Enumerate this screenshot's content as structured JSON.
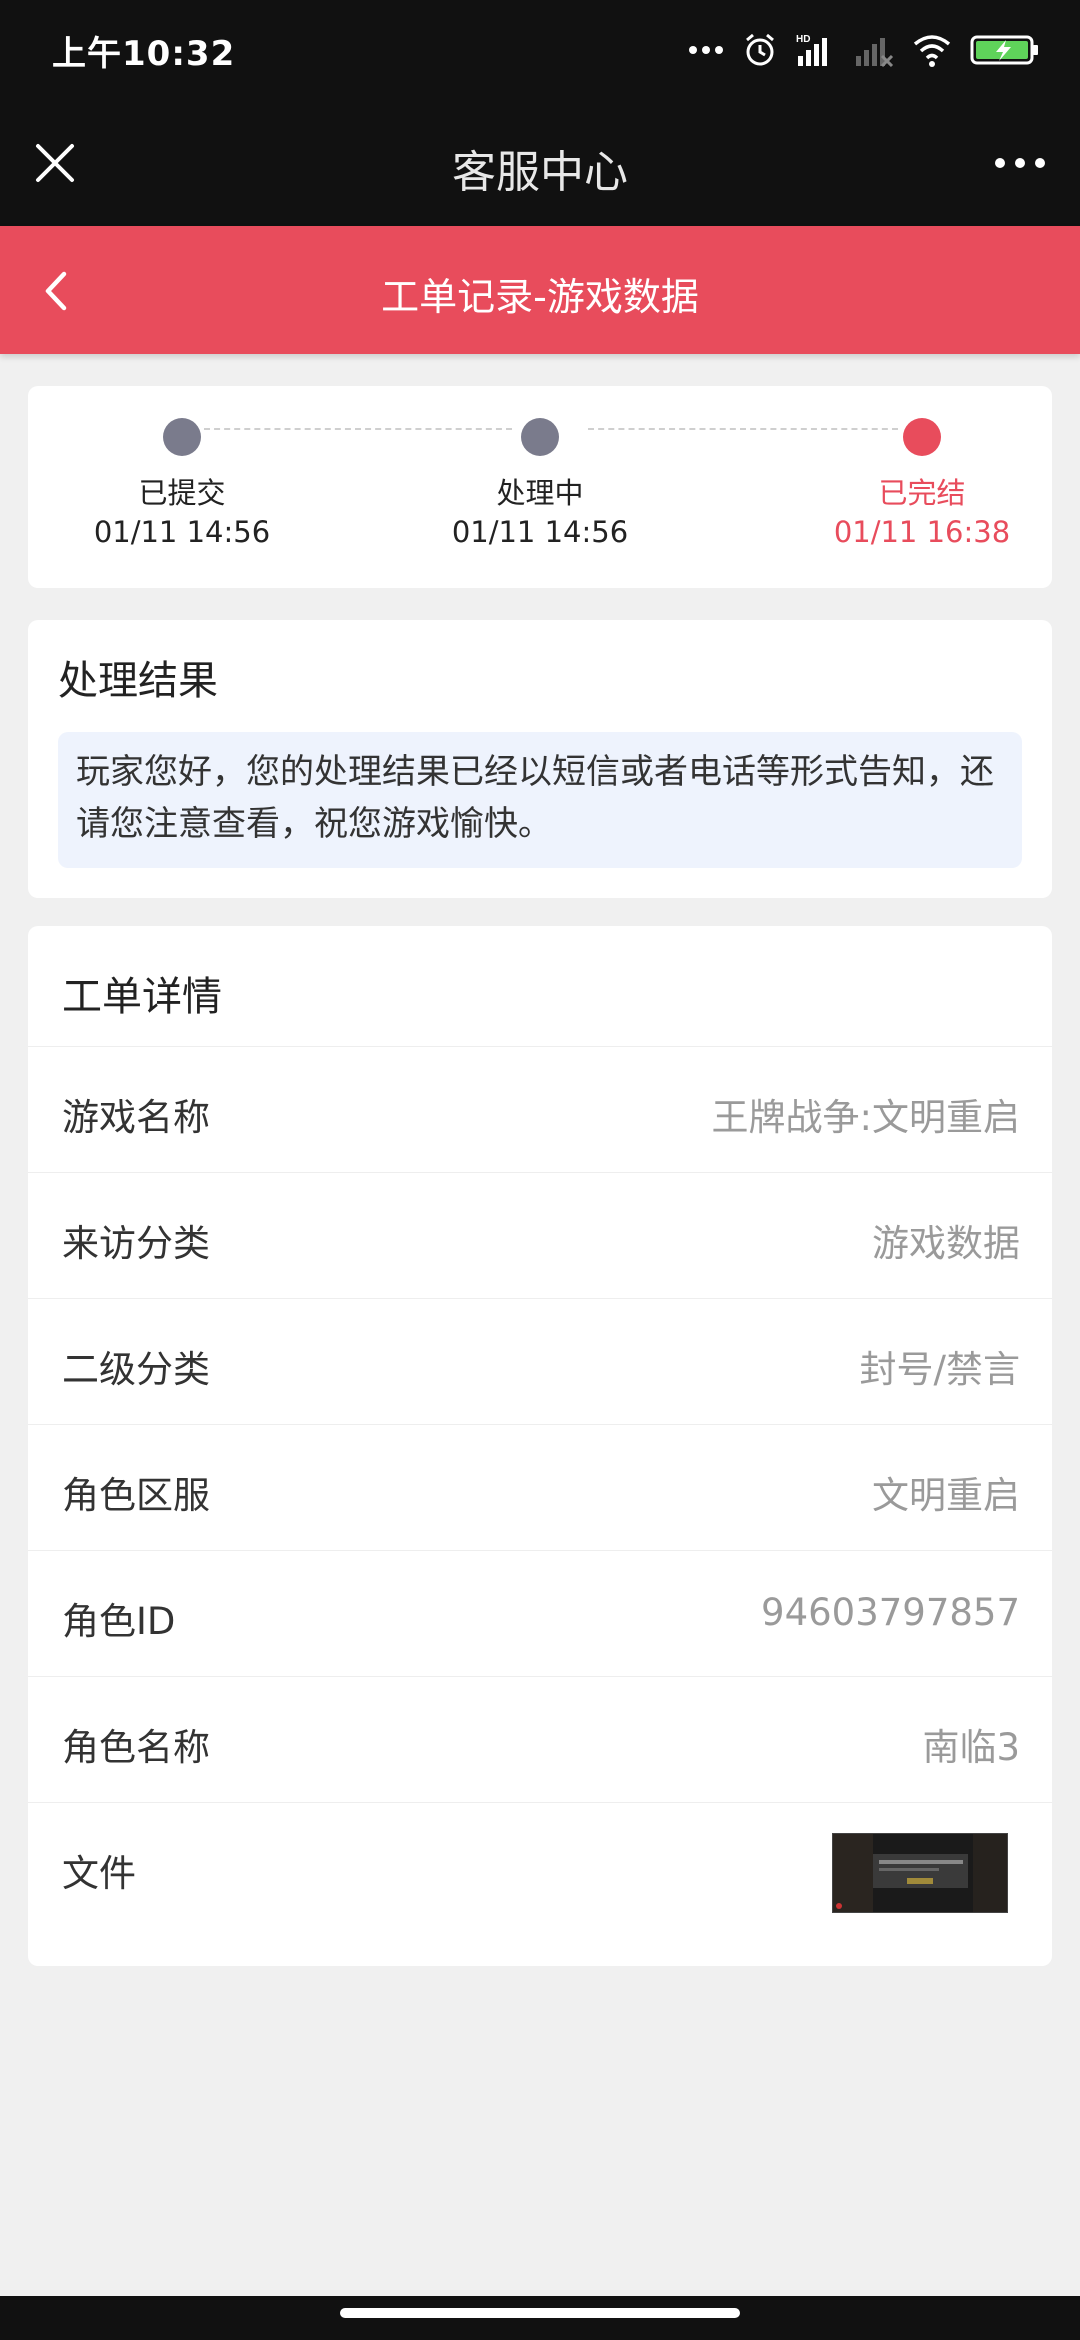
{
  "status_bar": {
    "time": "上午10:32",
    "icons": [
      "more-dots-icon",
      "alarm-icon",
      "hd-signal-icon",
      "signal-off-icon",
      "wifi-icon",
      "battery-charging-icon"
    ]
  },
  "title_bar": {
    "title": "客服中心",
    "close_icon": "close-icon",
    "more_icon": "more-icon"
  },
  "header": {
    "title": "工单记录-游戏数据",
    "accent_color": "#e84c5c"
  },
  "progress": {
    "steps": [
      {
        "label": "已提交",
        "time": "01/11 14:56"
      },
      {
        "label": "处理中",
        "time": "01/11 14:56"
      },
      {
        "label": "已完结",
        "time": "01/11 16:38"
      }
    ]
  },
  "result": {
    "heading": "处理结果",
    "message": "玩家您好，您的处理结果已经以短信或者电话等形式告知，还请您注意查看，祝您游戏愉快。"
  },
  "details": {
    "heading": "工单详情",
    "rows": [
      {
        "key": "游戏名称",
        "value": "王牌战争:文明重启"
      },
      {
        "key": "来访分类",
        "value": "游戏数据"
      },
      {
        "key": "二级分类",
        "value": "封号/禁言"
      },
      {
        "key": "角色区服",
        "value": "文明重启"
      },
      {
        "key": "角色ID",
        "value": "94603797857"
      },
      {
        "key": "角色名称",
        "value": "南临3"
      },
      {
        "key": "文件",
        "value": ""
      }
    ]
  }
}
